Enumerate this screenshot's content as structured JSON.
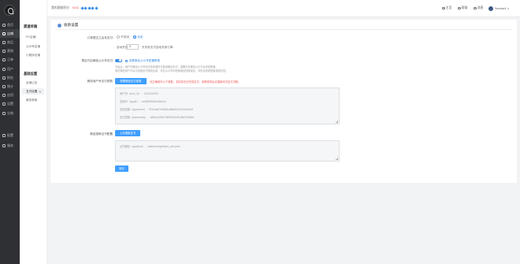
{
  "rail": {
    "items": [
      {
        "label": "首页",
        "active": false
      },
      {
        "label": "店铺",
        "active": true
      },
      {
        "label": "商品",
        "active": false
      },
      {
        "label": "营销",
        "active": false
      },
      {
        "label": "订单",
        "active": false
      },
      {
        "label": "用户",
        "active": false
      },
      {
        "label": "财务",
        "active": false
      },
      {
        "label": "统计",
        "active": false
      },
      {
        "label": "应用",
        "active": false
      },
      {
        "label": "设置",
        "active": false
      },
      {
        "label": "分销",
        "active": false
      },
      {
        "label": "配置",
        "active": false
      },
      {
        "label": "服务",
        "active": false
      }
    ]
  },
  "sub_sidebar": {
    "group1_title": "渠道终端",
    "group1_items": [
      "PC店铺",
      "公众号店铺",
      "小程序店铺"
    ],
    "group2_title": "基础设置",
    "group2_items": [
      {
        "label": "店铺公告",
        "active": false,
        "caret": ""
      },
      {
        "label": "支付设置",
        "active": true,
        "caret": "▸"
      },
      {
        "label": "服务条款",
        "active": false,
        "caret": ""
      }
    ]
  },
  "header": {
    "cs_text_prefix": "我的客服积分：",
    "cs_score": "9242",
    "links": [
      "主页",
      "帮助",
      "消息"
    ],
    "user": "Service1"
  },
  "page": {
    "title": "收款设置",
    "unpaid_label": "订单提交之后未支付:",
    "option_no_close": "不关闭",
    "option_close": "关闭",
    "close_prefix": "自动关闭",
    "close_minutes": "3",
    "close_suffix": "天内未支付自动关闭订单",
    "wechat_label": "是否开启微信公众号支付:",
    "wechat_link": "查看微信公众号配置教程",
    "wechat_tip1": "开启后，用户在微信公众号内浏览商城时可使用微信支付，需要先在微信公众平台完成配置。",
    "wechat_tip2": "需在微信商户平台中设置支付授权目录，并在公众号中配置网页授权域名，详情请查看配置说明文档。",
    "alipay_label": "微信商户号支付参数:",
    "alipay_btn": "配置微信支付参数",
    "alipay_warn": "请正确填写以下参数，否则将无法完成支付，参数修改后请重新测试支付流程。",
    "merchant_lines": [
      "商户号（mch_id）：1200219002",
      "应用ID（appid）：wx8829fb62e1f8a2c1",
      "应用密钥（appsecret）：5f1c0ab7e9f2d4c68a3b0e1f7d9c2a15",
      "支付密钥（partnerkey）：a8f3c1d29e7b4650f2a19c38d7e5b6f4"
    ],
    "cert_label": "微信退款证书配置:",
    "cert_btn": "上传退款证书",
    "cert_lines": [
      "证书路径（apiclient）：/data/cert/apiclient_cert.pem"
    ],
    "submit_btn": "保存"
  }
}
